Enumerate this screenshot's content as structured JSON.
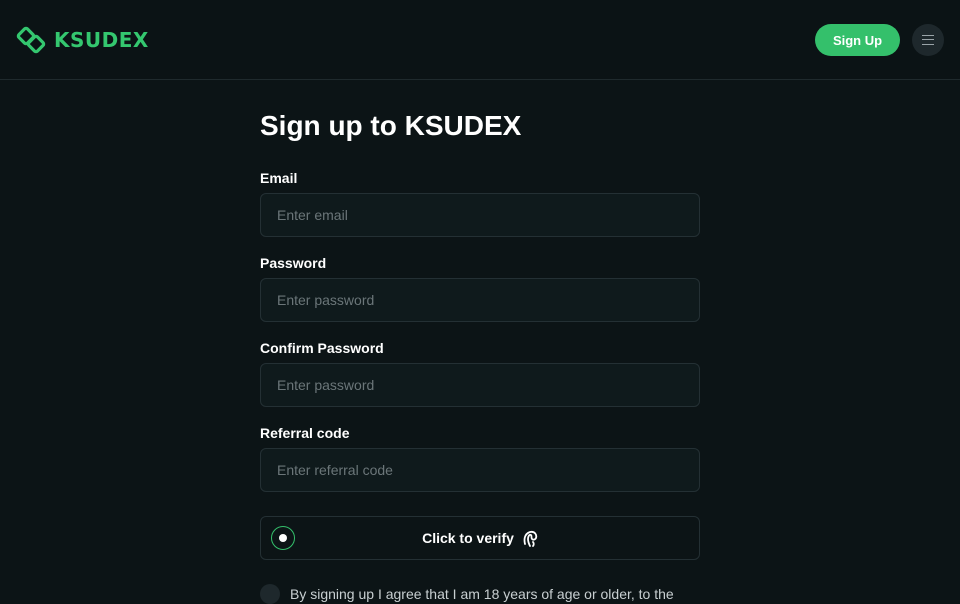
{
  "header": {
    "brand": "KSUDEX",
    "signup_label": "Sign Up",
    "accent_color": "#34c06b"
  },
  "form": {
    "title": "Sign up to KSUDEX",
    "fields": [
      {
        "label": "Email",
        "placeholder": "Enter email",
        "value": ""
      },
      {
        "label": "Password",
        "placeholder": "Enter password",
        "value": ""
      },
      {
        "label": "Confirm Password",
        "placeholder": "Enter password",
        "value": ""
      },
      {
        "label": "Referral code",
        "placeholder": "Enter referral code",
        "value": ""
      }
    ],
    "verify_label": "Click to verify",
    "agree_text": "By signing up I agree that I am 18 years of age or older, to the"
  },
  "icons": {
    "logo": "ksudex-logo-icon",
    "menu": "hamburger-menu-icon",
    "verify": "fingerprint-icon"
  }
}
